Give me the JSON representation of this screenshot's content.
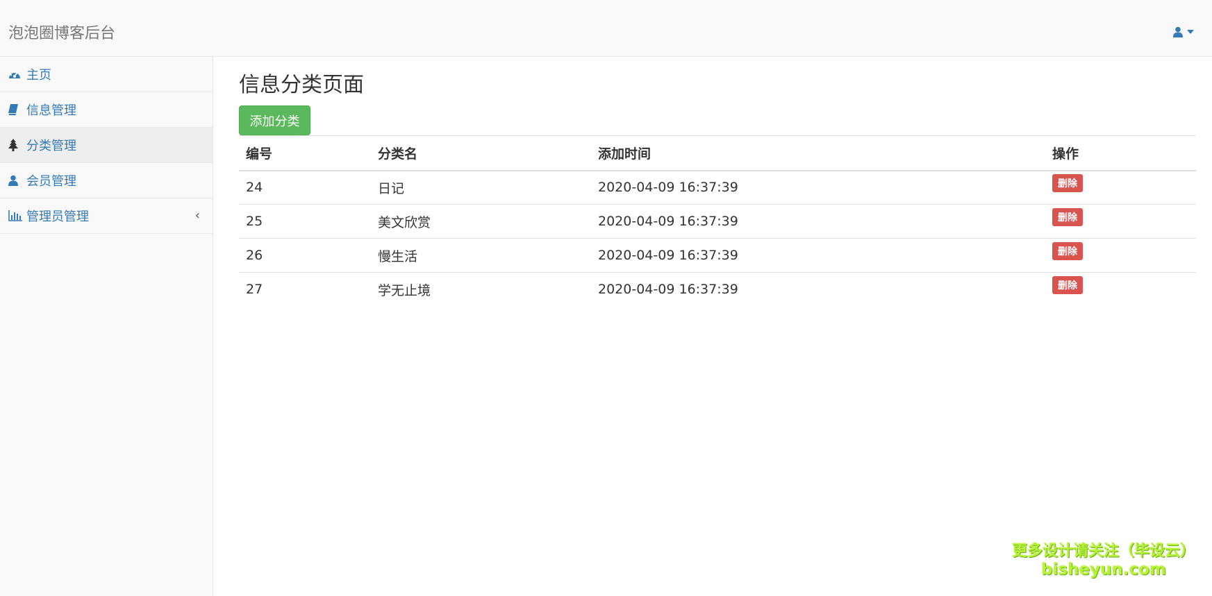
{
  "brand": "泡泡圈博客后台",
  "user_menu": {
    "icon": "user-icon",
    "caret": "caret-down-icon"
  },
  "sidebar": {
    "items": [
      {
        "label": "主页",
        "icon": "dashboard-icon",
        "active": false
      },
      {
        "label": "信息管理",
        "icon": "book-icon",
        "active": false
      },
      {
        "label": "分类管理",
        "icon": "tree-icon",
        "active": true
      },
      {
        "label": "会员管理",
        "icon": "user-icon",
        "active": false
      },
      {
        "label": "管理员管理",
        "icon": "bar-chart-icon",
        "active": false,
        "chevron": "‹"
      }
    ]
  },
  "main": {
    "title": "信息分类页面",
    "add_button": "添加分类",
    "table": {
      "headers": [
        "编号",
        "分类名",
        "添加时间",
        "操作"
      ],
      "rows": [
        {
          "id": "24",
          "name": "日记",
          "time": "2020-04-09 16:37:39",
          "action": "删除"
        },
        {
          "id": "25",
          "name": "美文欣赏",
          "time": "2020-04-09 16:37:39",
          "action": "删除"
        },
        {
          "id": "26",
          "name": "慢生活",
          "time": "2020-04-09 16:37:39",
          "action": "删除"
        },
        {
          "id": "27",
          "name": "学无止境",
          "time": "2020-04-09 16:37:39",
          "action": "删除"
        }
      ]
    }
  },
  "watermark": {
    "line1": "更多设计请关注（毕设云）",
    "line2": "bisheyun.com"
  },
  "colors": {
    "link": "#337ab7",
    "success": "#5cb85c",
    "danger": "#d9534f",
    "watermark": "#b6f23a"
  }
}
